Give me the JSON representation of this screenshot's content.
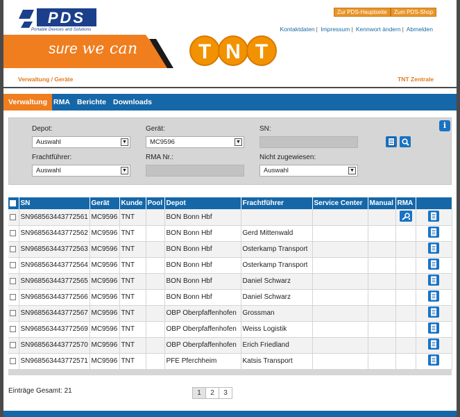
{
  "header": {
    "logo_text": "PDS",
    "logo_tagline": "Portable Devices and Solutions",
    "banner_text": "sure ",
    "banner_accent": "we can",
    "tnt_logo_text": "TNT",
    "btn_home": "Zur PDS-Hauptseite",
    "btn_shop": "Zum PDS-Shop",
    "links": [
      "Kontaktdaten",
      "Impressum",
      "Kennwort ändern",
      "Abmelden"
    ],
    "breadcrumb": "Verwaltung / Geräte",
    "region": "TNT Zentrale"
  },
  "nav": [
    "Verwaltung",
    "RMA",
    "Berichte",
    "Downloads"
  ],
  "filter": {
    "depot_label": "Depot:",
    "depot_value": "Auswahl",
    "geraet_label": "Gerät:",
    "geraet_value": "MC9596",
    "sn_label": "SN:",
    "fracht_label": "Frachtführer:",
    "fracht_value": "Auswahl",
    "rma_label": "RMA Nr.:",
    "nicht_label": "Nicht zugewiesen:",
    "nicht_value": "Auswahl"
  },
  "table": {
    "headers": [
      "SN",
      "Gerät",
      "Kunde",
      "Pool",
      "Depot",
      "Frachtführer",
      "Service Center",
      "Manual",
      "RMA"
    ],
    "rows": [
      {
        "sn": "SN968563443772561",
        "geraet": "MC9596",
        "kunde": "TNT",
        "pool": "",
        "depot": "BON Bonn Hbf",
        "fracht": "",
        "rma": true
      },
      {
        "sn": "SN968563443772562",
        "geraet": "MC9596",
        "kunde": "TNT",
        "pool": "",
        "depot": "BON Bonn Hbf",
        "fracht": "Gerd Mittenwald",
        "rma": false
      },
      {
        "sn": "SN968563443772563",
        "geraet": "MC9596",
        "kunde": "TNT",
        "pool": "",
        "depot": "BON Bonn Hbf",
        "fracht": "Osterkamp Transport",
        "rma": false
      },
      {
        "sn": "SN968563443772564",
        "geraet": "MC9596",
        "kunde": "TNT",
        "pool": "",
        "depot": "BON Bonn Hbf",
        "fracht": "Osterkamp Transport",
        "rma": false
      },
      {
        "sn": "SN968563443772565",
        "geraet": "MC9596",
        "kunde": "TNT",
        "pool": "",
        "depot": "BON Bonn Hbf",
        "fracht": "Daniel Schwarz",
        "rma": false
      },
      {
        "sn": "SN968563443772566",
        "geraet": "MC9596",
        "kunde": "TNT",
        "pool": "",
        "depot": "BON Bonn Hbf",
        "fracht": "Daniel Schwarz",
        "rma": false
      },
      {
        "sn": "SN968563443772567",
        "geraet": "MC9596",
        "kunde": "TNT",
        "pool": "",
        "depot": "OBP Oberpfaffenhofen",
        "fracht": "Grossman",
        "rma": false
      },
      {
        "sn": "SN968563443772569",
        "geraet": "MC9596",
        "kunde": "TNT",
        "pool": "",
        "depot": "OBP Oberpfaffenhofen",
        "fracht": "Weiss Logistik",
        "rma": false
      },
      {
        "sn": "SN968563443772570",
        "geraet": "MC9596",
        "kunde": "TNT",
        "pool": "",
        "depot": "OBP Oberpfaffenhofen",
        "fracht": "Erich Friedland",
        "rma": false
      },
      {
        "sn": "SN968563443772571",
        "geraet": "MC9596",
        "kunde": "TNT",
        "pool": "",
        "depot": "PFE Pferchheim",
        "fracht": "Katsis Transport",
        "rma": false
      }
    ]
  },
  "footer": {
    "total": "Einträge Gesamt: 21",
    "pages": [
      "1",
      "2",
      "3"
    ]
  },
  "colors": {
    "brand_blue": "#1567a8",
    "accent_orange": "#f07d1e",
    "tnt_orange": "#f39200"
  },
  "icons": [
    "document-icon",
    "search-icon",
    "info-icon",
    "rma-wrench-icon",
    "dropdown-arrow-icon"
  ]
}
